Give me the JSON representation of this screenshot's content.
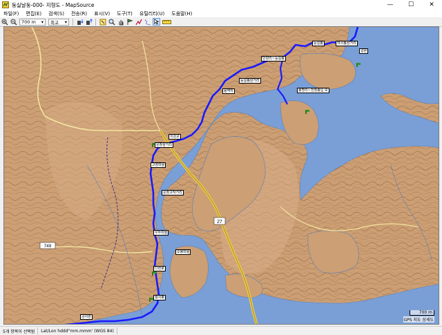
{
  "window": {
    "title": "둥실날둥-000- 지형도 - MapSource",
    "minimize_glyph": "—",
    "maximize_glyph": "☐",
    "close_glyph": "✕"
  },
  "menu": [
    "파일(F)",
    "편집(E)",
    "검색(S)",
    "전송(R)",
    "표시(V)",
    "도구(T)",
    "유틸리티(U)",
    "도움말(H)"
  ],
  "toolbar": {
    "zoom_value": "700 m",
    "detail_value": "최고",
    "icons": [
      "zoom-in-icon",
      "zoom-out-icon",
      "device-receive-icon",
      "device-send-icon",
      "selection-tool-icon",
      "zoom-tool-icon",
      "hand-tool-icon",
      "waypoint-tool-icon",
      "route-tool-icon",
      "track-tool-icon",
      "measure-tool-icon"
    ]
  },
  "map": {
    "water_color": "#7a9fd6",
    "land_color": "#cc9f74",
    "contour_color": "#8a5a38",
    "track_color": "#1a1aff",
    "labels": {
      "l1": "여사봉삼거리",
      "l2": "갈론",
      "l3": "단양리~둥실봉",
      "l4": "둥실봉삼거리",
      "l5": "음역자",
      "l6": "둥실봉",
      "l7": "봉명리~천청봉입 보",
      "l8": "이강교",
      "l9": "운창삼거리",
      "l10": "고장마을",
      "l11": "운창고작거리",
      "l12": "우두마을",
      "l13": "오봉마을",
      "l14": "다현로",
      "l15": "월사평",
      "l16": "금사관"
    },
    "road_numbers": {
      "r1": "27",
      "r2": "749"
    },
    "scale_text": "700 m",
    "credit": "GPS 지도 상세도"
  },
  "status": {
    "selection": "5개 항목이 선택됨",
    "coord_format": "Lat/Lon hddd°mm.mmm' (WGS 84)"
  }
}
